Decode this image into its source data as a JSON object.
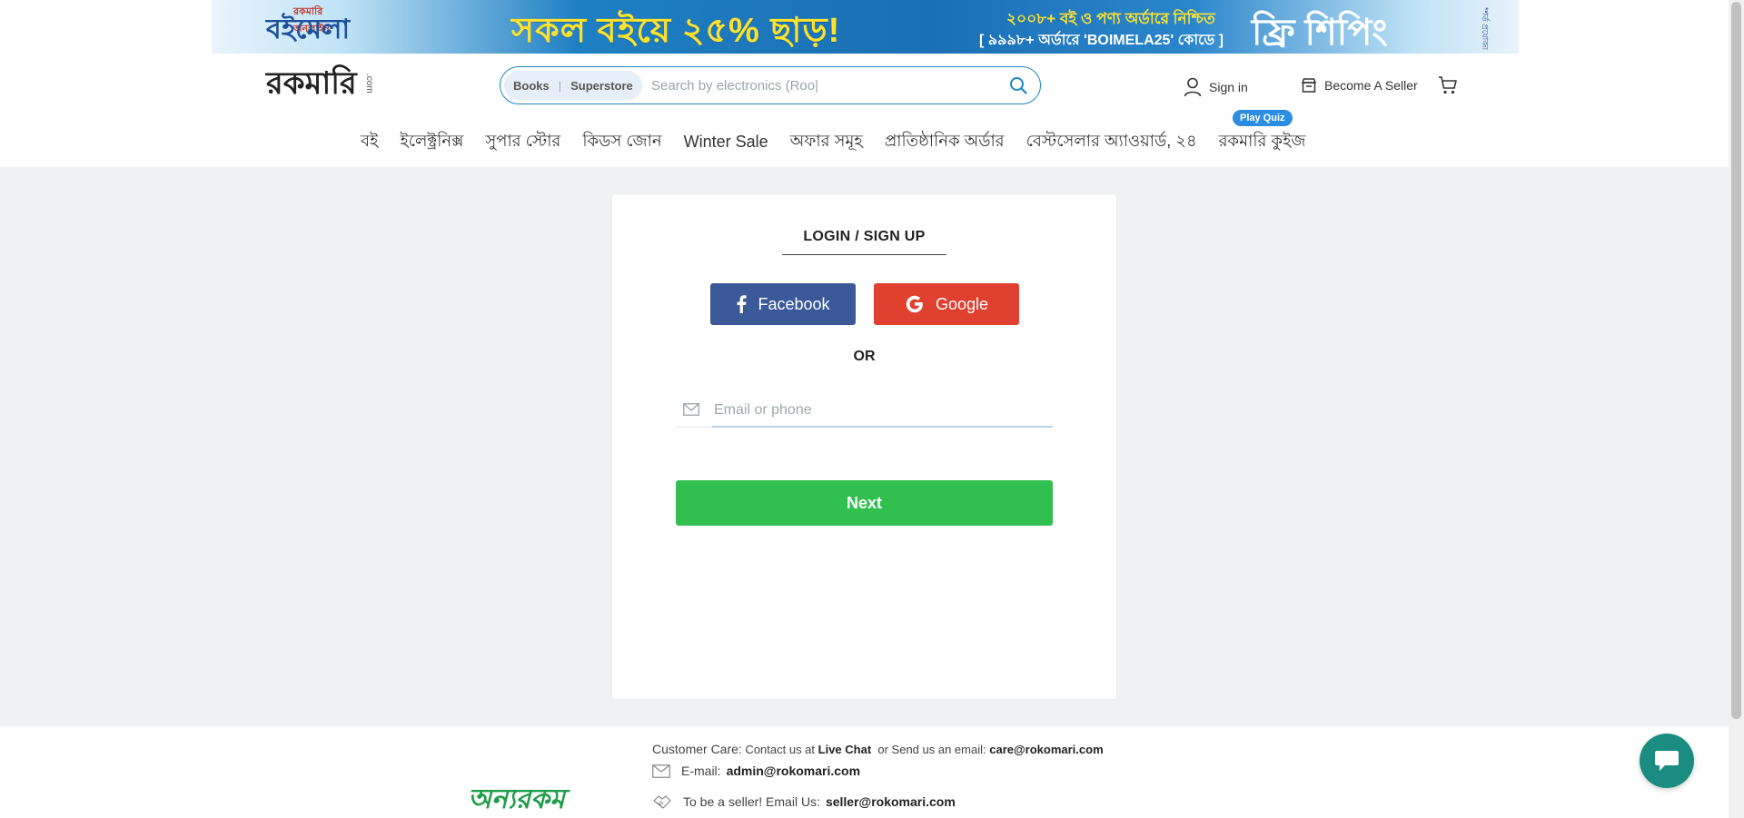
{
  "banner": {
    "brand_top": "রকমারি অনলাইন",
    "brand_main": "বইমেলা",
    "headline": "সকল বইয়ে ২৫% ছাড়!",
    "offer_line1": "২০০৮+ বই ও পণ্য অর্ডারে নিশ্চিত",
    "offer_line2": "[ ৯৯৯৮+ অর্ডারে 'BOIMELA25' কোডে ]",
    "shipping": "ফ্রি শিপিং",
    "note": "*শর্ত প্রযোজ্য"
  },
  "header": {
    "logo_text": "রকমারি",
    "logo_suffix": ".com",
    "search": {
      "tab_books": "Books",
      "tab_superstore": "Superstore",
      "placeholder": "Search by electronics (Roo|"
    },
    "signin_label": "Sign in",
    "seller_label": "Become A Seller"
  },
  "nav": {
    "items": [
      "বই",
      "ইলেক্ট্রনিক্স",
      "সুপার স্টোর",
      "কিডস জোন",
      "Winter Sale",
      "অফার সমূহ",
      "প্রাতিষ্ঠানিক অর্ডার",
      "বেস্টসেলার অ্যাওয়ার্ড, ২৪",
      "রকমারি কুইজ"
    ],
    "quiz_badge": "Play Quiz"
  },
  "login": {
    "title": "LOGIN / SIGN UP",
    "facebook_label": "Facebook",
    "google_label": "Google",
    "or_label": "OR",
    "email_placeholder": "Email or phone",
    "next_label": "Next"
  },
  "footer": {
    "brand": "অন্যরকম",
    "care_label": "Customer  Care:",
    "care_text": " Contact us at ",
    "live_chat": "Live Chat",
    "care_text2": "  or Send us an email: ",
    "care_email": "care@rokomari.com",
    "email_label": "E-mail:",
    "admin_email": "admin@rokomari.com",
    "seller_label": "To be a seller!  Email Us:",
    "seller_email": "seller@rokomari.com"
  },
  "colors": {
    "accent_blue": "#1b86c6",
    "facebook": "#3b5898",
    "google": "#e0402f",
    "next_green": "#31c050",
    "chat_teal": "#1a8c80"
  }
}
